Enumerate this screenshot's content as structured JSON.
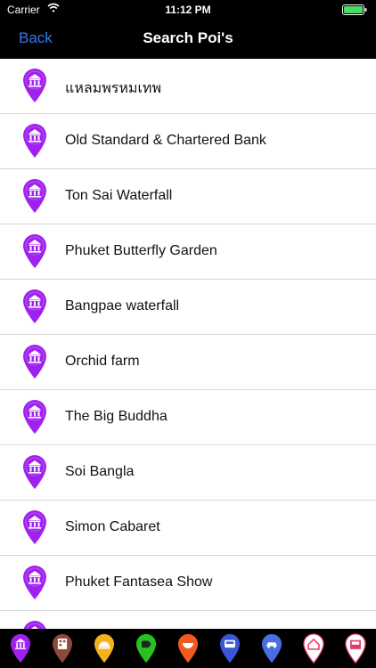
{
  "status": {
    "carrier": "Carrier",
    "time": "11:12 PM"
  },
  "nav": {
    "back_label": "Back",
    "title": "Search Poi's"
  },
  "colors": {
    "pin": "#a020f0",
    "nav_bg": "#000000",
    "back_text": "#3478f6"
  },
  "pois": [
    {
      "name": "แหลมพรหมเทพ"
    },
    {
      "name": "Old Standard & Chartered Bank"
    },
    {
      "name": "Ton Sai Waterfall"
    },
    {
      "name": "Phuket Butterfly Garden"
    },
    {
      "name": "Bangpae waterfall"
    },
    {
      "name": "Orchid farm"
    },
    {
      "name": "The Big Buddha"
    },
    {
      "name": "Soi Bangla"
    },
    {
      "name": "Simon Cabaret"
    },
    {
      "name": "Phuket Fantasea Show"
    },
    {
      "name": ""
    }
  ],
  "categories": [
    {
      "icon": "attraction-icon",
      "color": "#a020f0"
    },
    {
      "icon": "hotel-icon",
      "color": "#8b4a3c"
    },
    {
      "icon": "restaurant-icon",
      "color": "#f2b21c"
    },
    {
      "icon": "cafe-icon",
      "color": "#27c21f"
    },
    {
      "icon": "food-icon",
      "color": "#f05a1e"
    },
    {
      "icon": "bus-icon",
      "color": "#3a57d6"
    },
    {
      "icon": "car-icon",
      "color": "#4a6de0"
    },
    {
      "icon": "home-icon",
      "color": "#ffffff"
    },
    {
      "icon": "shop-icon",
      "color": "#ffffff"
    }
  ]
}
